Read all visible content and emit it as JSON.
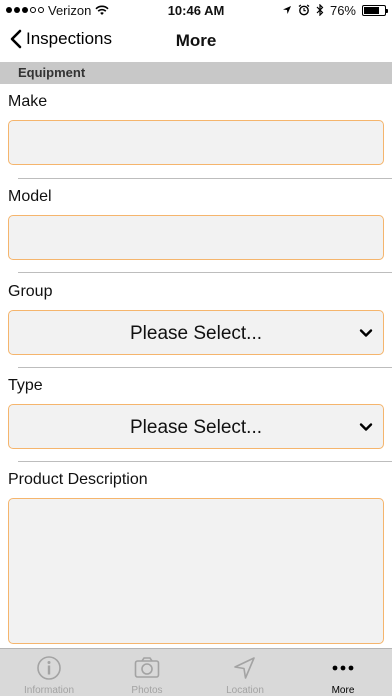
{
  "status_bar": {
    "carrier": "Verizon",
    "time": "10:46 AM",
    "battery": "76%",
    "battery_level": 0.76
  },
  "nav": {
    "back_label": "Inspections",
    "title": "More"
  },
  "section": {
    "title": "Equipment"
  },
  "form": {
    "make_label": "Make",
    "make_value": "",
    "model_label": "Model",
    "model_value": "",
    "group_label": "Group",
    "group_value": "Please Select...",
    "type_label": "Type",
    "type_value": "Please Select...",
    "description_label": "Product Description",
    "description_value": ""
  },
  "tabs": [
    {
      "label": "Information",
      "icon": "info-icon",
      "active": false
    },
    {
      "label": "Photos",
      "icon": "camera-icon",
      "active": false
    },
    {
      "label": "Location",
      "icon": "location-arrow-icon",
      "active": false
    },
    {
      "label": "More",
      "icon": "more-dots-icon",
      "active": true
    }
  ],
  "colors": {
    "input_border": "#f5b56d",
    "section_bg": "#c8c8c8",
    "tab_bar_bg": "#d9d9d9"
  }
}
